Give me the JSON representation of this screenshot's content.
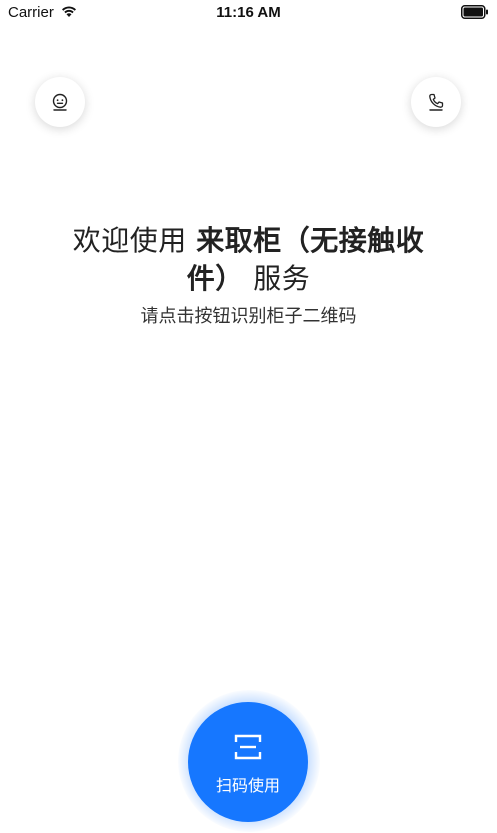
{
  "status_bar": {
    "carrier": "Carrier",
    "time": "11:16 AM"
  },
  "header": {
    "left_button_icon": "robot-service-icon",
    "right_button_icon": "phone-icon"
  },
  "main": {
    "title_prefix": "欢迎使用",
    "title_bold": "来取柜（无接触收件）",
    "title_suffix": "服务",
    "subtitle": "请点击按钮识别柜子二维码"
  },
  "scan": {
    "label": "扫码使用",
    "icon": "scan-icon"
  },
  "colors": {
    "accent": "#1677ff",
    "background": "#ffffff",
    "text": "#222222"
  }
}
